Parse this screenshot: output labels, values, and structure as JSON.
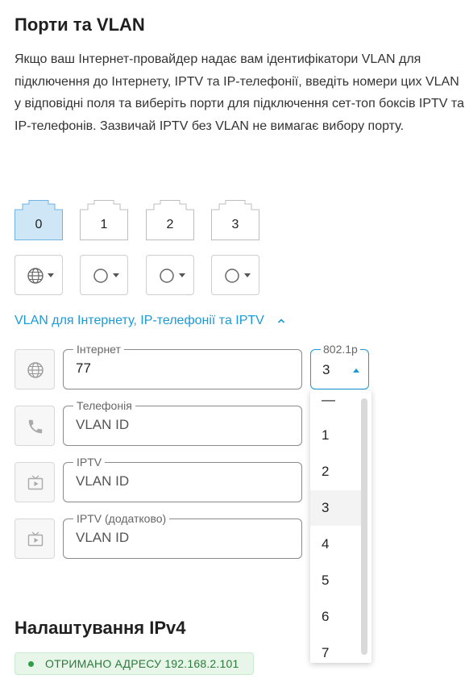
{
  "ports_section": {
    "title": "Порти та VLAN",
    "description": "Якщо ваш Інтернет-провайдер надає вам ідентифікатори VLAN для підключення до Інтернету, IPTV та IP-телефонії, введіть номери цих VLAN у відповідні поля та виберіть порти для підключення сет-топ боксів IPTV та IP-телефонів. Зазвичай IPTV без VLAN не вимагає вибору порту."
  },
  "ports": [
    {
      "label": "0",
      "selected": true,
      "mode_icon": "globe-icon"
    },
    {
      "label": "1",
      "selected": false,
      "mode_icon": "circle-icon"
    },
    {
      "label": "2",
      "selected": false,
      "mode_icon": "circle-icon"
    },
    {
      "label": "3",
      "selected": false,
      "mode_icon": "circle-icon"
    }
  ],
  "vlan": {
    "toggle_label": "VLAN для Інтернету, IP-телефонії та IPTV",
    "internet": {
      "label": "Інтернет",
      "value": "77",
      "icon": "globe-icon"
    },
    "telephony": {
      "label": "Телефонія",
      "placeholder": "VLAN ID",
      "icon": "phone-icon"
    },
    "iptv": {
      "label": "IPTV",
      "placeholder": "VLAN ID",
      "icon": "tv-icon"
    },
    "iptv_extra": {
      "label": "IPTV (додатково)",
      "placeholder": "VLAN ID",
      "icon": "tv-icon"
    },
    "priority": {
      "label": "802.1p",
      "value": "3",
      "options": [
        "—",
        "1",
        "2",
        "3",
        "4",
        "5",
        "6",
        "7"
      ]
    }
  },
  "ipv4_section": {
    "title": "Налаштування IPv4",
    "status": "ОТРИМАНО АДРЕСУ 192.168.2.101"
  },
  "colors": {
    "accent": "#1a9ad6",
    "selected_port_fill": "#cfe6f6",
    "status_green": "#2e9e48"
  }
}
